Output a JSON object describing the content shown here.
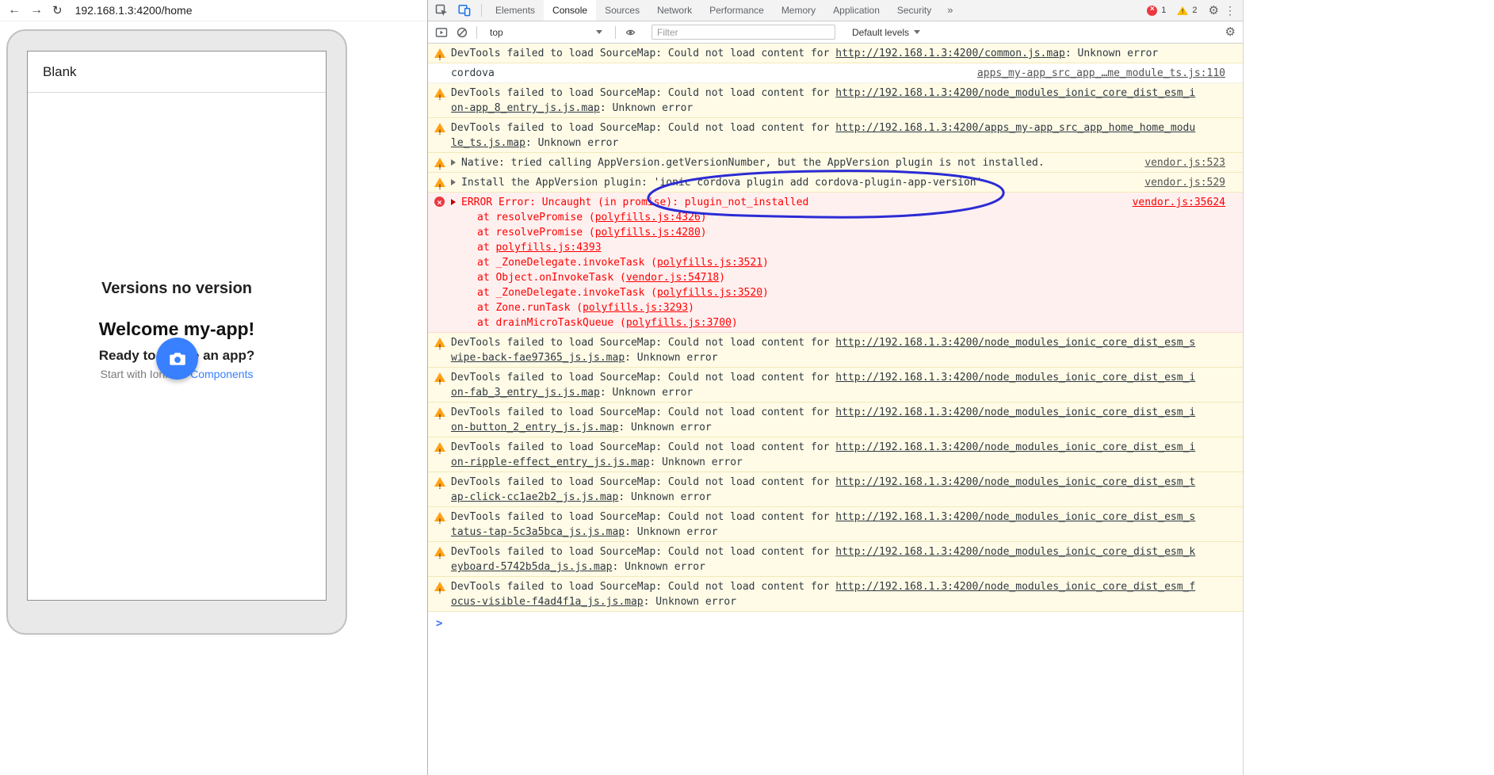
{
  "browser": {
    "url": "192.168.1.3:4200/home"
  },
  "icons": {
    "back": "←",
    "forward": "→",
    "reload": "↻",
    "gear": "⚙",
    "kebab": "⋮",
    "overflow_chevron": "»"
  },
  "app": {
    "header_title": "Blank",
    "title1": "Versions no version",
    "title2": "Welcome my-app!",
    "title3": "Ready to create an app?",
    "subtitle_prefix": "Start with Ionic ",
    "subtitle_link": "UI Components"
  },
  "devtools": {
    "tabs": [
      "Elements",
      "Console",
      "Sources",
      "Network",
      "Performance",
      "Memory",
      "Application",
      "Security"
    ],
    "active_tab": "Console",
    "error_count": "1",
    "warning_count": "2",
    "toolbar": {
      "context": "top",
      "filter_placeholder": "Filter",
      "levels": "Default levels"
    }
  },
  "colors": {
    "accent_blue": "#1a73e8",
    "fab_blue": "#3880ff",
    "warning_bg": "#fffbe6",
    "error_bg": "#fff0f0",
    "error_text": "#ff0000",
    "annotation_blue": "#2b2bd4"
  },
  "console": {
    "prompt": ">",
    "messages": [
      {
        "kind": "warning",
        "prefix": "DevTools failed to load SourceMap: Could not load content for ",
        "url": "http://192.168.1.3:4200/common.js.map",
        "suffix": ": Unknown error"
      },
      {
        "kind": "log",
        "text": "cordova",
        "source": "apps_my-app_src_app_…me_module_ts.js:110"
      },
      {
        "kind": "warning",
        "prefix": "DevTools failed to load SourceMap: Could not load content for ",
        "url": "http://192.168.1.3:4200/node_modules_ionic_core_dist_esm_ion-app_8_entry_js.js.map",
        "suffix": ": Unknown error"
      },
      {
        "kind": "warning",
        "prefix": "DevTools failed to load SourceMap: Could not load content for ",
        "url": "http://192.168.1.3:4200/apps_my-app_src_app_home_home_module_ts.js.map",
        "suffix": ": Unknown error"
      },
      {
        "kind": "warning",
        "expandable": true,
        "text": "Native: tried calling AppVersion.getVersionNumber, but the AppVersion plugin is not installed.",
        "source": "vendor.js:523"
      },
      {
        "kind": "warning",
        "expandable": true,
        "text": "Install the AppVersion plugin: 'ionic cordova plugin add cordova-plugin-app-version'",
        "source": "vendor.js:529"
      },
      {
        "kind": "error",
        "expandable": true,
        "text": "ERROR Error: Uncaught (in promise): plugin_not_installed",
        "source": "vendor.js:35624",
        "stack": [
          {
            "pre": "at resolvePromise (",
            "link": "polyfills.js:4326",
            "post": ")"
          },
          {
            "pre": "at resolvePromise (",
            "link": "polyfills.js:4280",
            "post": ")"
          },
          {
            "pre": "at ",
            "link": "polyfills.js:4393",
            "post": ""
          },
          {
            "pre": "at _ZoneDelegate.invokeTask (",
            "link": "polyfills.js:3521",
            "post": ")"
          },
          {
            "pre": "at Object.onInvokeTask (",
            "link": "vendor.js:54718",
            "post": ")"
          },
          {
            "pre": "at _ZoneDelegate.invokeTask (",
            "link": "polyfills.js:3520",
            "post": ")"
          },
          {
            "pre": "at Zone.runTask (",
            "link": "polyfills.js:3293",
            "post": ")"
          },
          {
            "pre": "at drainMicroTaskQueue (",
            "link": "polyfills.js:3700",
            "post": ")"
          }
        ]
      },
      {
        "kind": "warning",
        "prefix": "DevTools failed to load SourceMap: Could not load content for ",
        "url": "http://192.168.1.3:4200/node_modules_ionic_core_dist_esm_swipe-back-fae97365_js.js.map",
        "suffix": ": Unknown error"
      },
      {
        "kind": "warning",
        "prefix": "DevTools failed to load SourceMap: Could not load content for ",
        "url": "http://192.168.1.3:4200/node_modules_ionic_core_dist_esm_ion-fab_3_entry_js.js.map",
        "suffix": ": Unknown error"
      },
      {
        "kind": "warning",
        "prefix": "DevTools failed to load SourceMap: Could not load content for ",
        "url": "http://192.168.1.3:4200/node_modules_ionic_core_dist_esm_ion-button_2_entry_js.js.map",
        "suffix": ": Unknown error"
      },
      {
        "kind": "warning",
        "prefix": "DevTools failed to load SourceMap: Could not load content for ",
        "url": "http://192.168.1.3:4200/node_modules_ionic_core_dist_esm_ion-ripple-effect_entry_js.js.map",
        "suffix": ": Unknown error"
      },
      {
        "kind": "warning",
        "prefix": "DevTools failed to load SourceMap: Could not load content for ",
        "url": "http://192.168.1.3:4200/node_modules_ionic_core_dist_esm_tap-click-cc1ae2b2_js.js.map",
        "suffix": ": Unknown error"
      },
      {
        "kind": "warning",
        "prefix": "DevTools failed to load SourceMap: Could not load content for ",
        "url": "http://192.168.1.3:4200/node_modules_ionic_core_dist_esm_status-tap-5c3a5bca_js.js.map",
        "suffix": ": Unknown error"
      },
      {
        "kind": "warning",
        "prefix": "DevTools failed to load SourceMap: Could not load content for ",
        "url": "http://192.168.1.3:4200/node_modules_ionic_core_dist_esm_keyboard-5742b5da_js.js.map",
        "suffix": ": Unknown error"
      },
      {
        "kind": "warning",
        "prefix": "DevTools failed to load SourceMap: Could not load content for ",
        "url": "http://192.168.1.3:4200/node_modules_ionic_core_dist_esm_focus-visible-f4ad4f1a_js.js.map",
        "suffix": ": Unknown error"
      }
    ]
  }
}
